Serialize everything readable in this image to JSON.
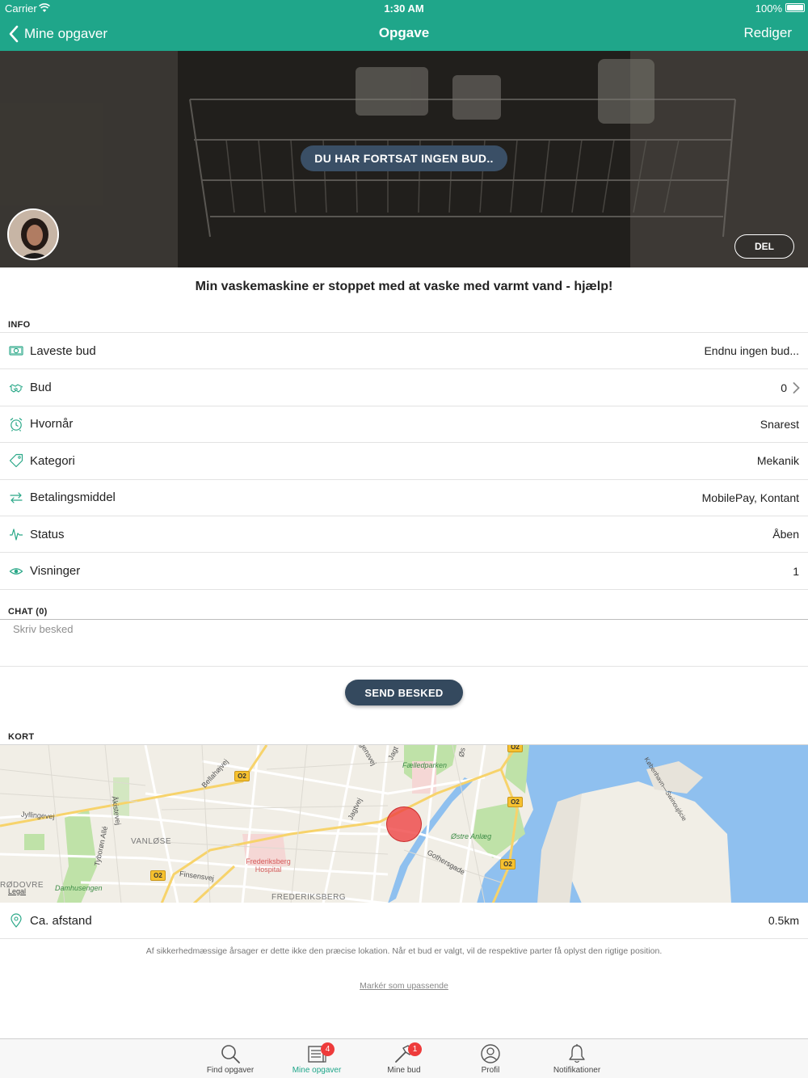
{
  "status_bar": {
    "carrier": "Carrier",
    "time": "1:30 AM",
    "battery": "100%"
  },
  "nav": {
    "back_label": "Mine opgaver",
    "title": "Opgave",
    "edit_label": "Rediger"
  },
  "hero": {
    "badge": "DU HAR FORTSAT INGEN BUD..",
    "share_label": "DEL"
  },
  "task": {
    "title": "Min vaskemaskine er stoppet med at vaske med varmt vand - hjælp!"
  },
  "info": {
    "section_label": "INFO",
    "rows": [
      {
        "icon": "cash-icon",
        "label": "Laveste bud",
        "value": "Endnu ingen bud..."
      },
      {
        "icon": "handshake-icon",
        "label": "Bud",
        "value": "0"
      },
      {
        "icon": "alarm-clock-icon",
        "label": "Hvornår",
        "value": "Snarest"
      },
      {
        "icon": "tag-icon",
        "label": "Kategori",
        "value": "Mekanik"
      },
      {
        "icon": "transfer-icon",
        "label": "Betalingsmiddel",
        "value": "MobilePay, Kontant"
      },
      {
        "icon": "pulse-icon",
        "label": "Status",
        "value": "Åben"
      },
      {
        "icon": "eye-icon",
        "label": "Visninger",
        "value": "1"
      }
    ]
  },
  "chat": {
    "section_label": "CHAT (0)",
    "placeholder": "Skriv besked",
    "send_label": "SEND BESKED"
  },
  "map": {
    "section_label": "KORT",
    "legal": "Legal",
    "labels": {
      "faelledparken": "Fælledparken",
      "ostre_anlaeg": "Østre Anlæg",
      "frederiksberg_hospital": "Frederiksberg Hospital",
      "damhusengen": "Damhusengen",
      "vanlose": "VANLØSE",
      "frederiksberg": "FREDERIKSBERG",
      "rodovre": "RØDOVRE",
      "jyllingevej": "Jyllingevej",
      "finsensvej": "Finsensvej",
      "bellahojvej": "Bellahøjvej",
      "aakandevej": "Åkistevej",
      "tyboron_alle": "Tyborøn Allé",
      "jagtvej": "Jagtvej",
      "jagtvej2": "Jagt",
      "gothersgade": "Gothersgade",
      "kbh_swinoujscie": "København—Świnoujście",
      "gensvej": "gensvej",
      "os": "Øs",
      "road_shield": "O2"
    },
    "distance_label": "Ca. afstand",
    "distance_value": "0.5km"
  },
  "disclaimer": "Af sikkerhedmæssige årsager er dette ikke den præcise lokation. Når et bud er valgt, vil de respektive parter få oplyst den rigtige position.",
  "report_link": "Markér som upassende",
  "tabs": [
    {
      "icon": "search-icon",
      "label": "Find opgaver",
      "badge": ""
    },
    {
      "icon": "newspaper-icon",
      "label": "Mine opgaver",
      "badge": "4",
      "active": true
    },
    {
      "icon": "hammer-icon",
      "label": "Mine bud",
      "badge": "1"
    },
    {
      "icon": "profile-icon",
      "label": "Profil",
      "badge": ""
    },
    {
      "icon": "bell-icon",
      "label": "Notifikationer",
      "badge": ""
    }
  ],
  "colors": {
    "brand": "#1fa68a",
    "button_dark": "#34495e",
    "badge_red": "#ee3b3b",
    "icon_teal": "#2aa888"
  }
}
